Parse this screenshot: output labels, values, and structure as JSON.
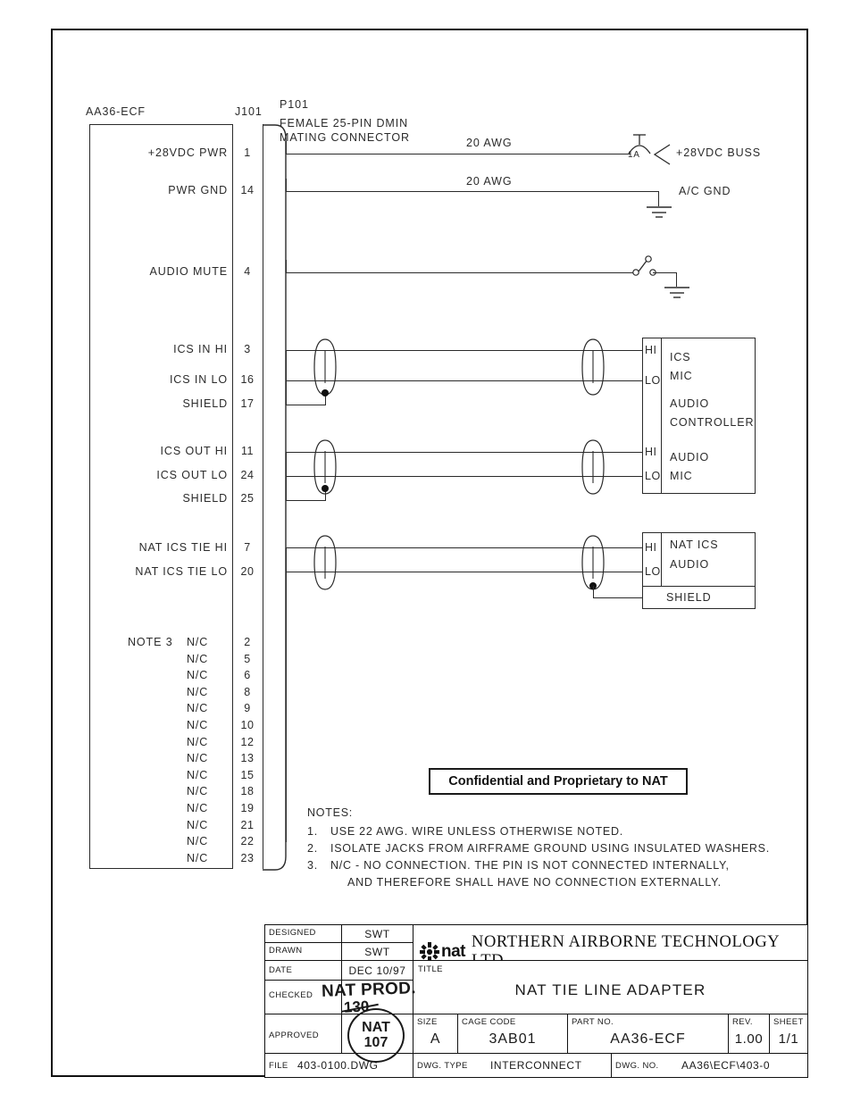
{
  "drawing": {
    "unit_label": "AA36-ECF",
    "connector_ref": "J101",
    "mating": {
      "ref": "P101",
      "line1": "FEMALE 25-PIN DMIN",
      "line2": "MATING CONNECTOR"
    },
    "signals": [
      {
        "label": "+28VDC PWR",
        "pin": "1"
      },
      {
        "label": "PWR GND",
        "pin": "14"
      },
      {
        "label": "AUDIO MUTE",
        "pin": "4"
      },
      {
        "label": "ICS IN HI",
        "pin": "3"
      },
      {
        "label": "ICS IN LO",
        "pin": "16"
      },
      {
        "label": "SHIELD",
        "pin": "17"
      },
      {
        "label": "ICS OUT HI",
        "pin": "11"
      },
      {
        "label": "ICS OUT LO",
        "pin": "24"
      },
      {
        "label": "SHIELD",
        "pin": "25"
      },
      {
        "label": "NAT ICS TIE HI",
        "pin": "7"
      },
      {
        "label": "NAT ICS TIE LO",
        "pin": "20"
      }
    ],
    "nc_note_label": "NOTE 3",
    "nc_label": "N/C",
    "nc_pins": [
      "2",
      "5",
      "6",
      "8",
      "9",
      "10",
      "12",
      "13",
      "15",
      "18",
      "19",
      "21",
      "22",
      "23"
    ],
    "wire_gauge_power": "20 AWG",
    "wire_gauge_gnd": "20 AWG",
    "breaker_rating": "1A",
    "buss_label": "+28VDC BUSS",
    "ac_gnd_label": "A/C GND",
    "audio_controller": {
      "pin_hi": "HI",
      "pin_lo": "LO",
      "line1": "ICS",
      "line2": "MIC",
      "line3": "AUDIO",
      "line4": "CONTROLLER",
      "line5": "AUDIO",
      "line6": "MIC"
    },
    "nat_ics_box": {
      "pin_hi": "HI",
      "pin_lo": "LO",
      "line1": "NAT ICS",
      "line2": "AUDIO",
      "shield": "SHIELD"
    }
  },
  "confidential": "Confidential and Proprietary to NAT",
  "notes": {
    "heading": "NOTES:",
    "items": [
      {
        "num": "1.",
        "text": "USE 22 AWG. WIRE UNLESS OTHERWISE NOTED."
      },
      {
        "num": "2.",
        "text": "ISOLATE JACKS FROM AIRFRAME GROUND USING INSULATED WASHERS."
      },
      {
        "num": "3.",
        "text": "N/C - NO CONNECTION.  THE PIN IS NOT CONNECTED INTERNALLY,"
      },
      {
        "num": "",
        "text": "AND THEREFORE SHALL HAVE NO CONNECTION EXTERNALLY."
      }
    ]
  },
  "title_block": {
    "designed_label": "DESIGNED",
    "designed_value": "SWT",
    "drawn_label": "DRAWN",
    "drawn_value": "SWT",
    "date_label": "DATE",
    "date_value": "DEC 10/97",
    "checked_label": "CHECKED",
    "approved_label": "APPROVED",
    "company_name": "NORTHERN AIRBORNE TECHNOLOGY LTD.",
    "logo_word": "nat",
    "title_label": "TITLE",
    "title_value": "NAT TIE LINE ADAPTER",
    "size_label": "SIZE",
    "size_value": "A",
    "cage_label": "CAGE CODE",
    "cage_value": "3AB01",
    "part_label": "PART NO.",
    "part_value": "AA36-ECF",
    "rev_label": "REV.",
    "rev_value": "1.00",
    "sheet_label": "SHEET",
    "sheet_value": "1/1",
    "file_label": "FILE",
    "file_value": "403-0100.DWG",
    "dwg_type_label": "DWG. TYPE",
    "dwg_type_value": "INTERCONNECT",
    "dwg_no_label": "DWG. NO.",
    "dwg_no_value": "AA36\\ECF\\403-0"
  },
  "stamps": {
    "prod_text": "NAT PROD.",
    "prod_num": "130",
    "circle_line1": "NAT",
    "circle_line2": "107"
  }
}
